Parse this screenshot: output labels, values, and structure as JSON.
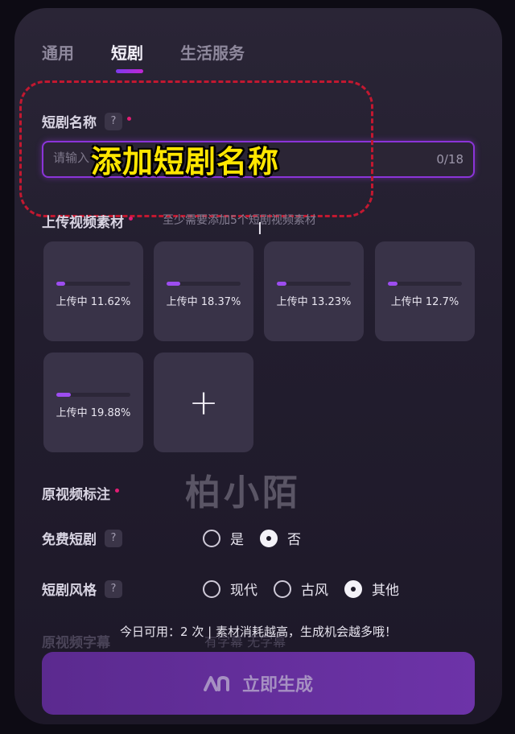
{
  "tabs": [
    {
      "label": "通用",
      "active": false
    },
    {
      "label": "短剧",
      "active": true
    },
    {
      "label": "生活服务",
      "active": false
    }
  ],
  "drama_name": {
    "label": "短剧名称",
    "help": "?",
    "placeholder": "请输入",
    "value": "",
    "counter": "0/18",
    "overlay_caption": "添加短剧名称"
  },
  "upload": {
    "label": "上传视频素材",
    "hint": "至少需要添加5个短剧视频素材",
    "items": [
      {
        "status": "上传中 11.62%",
        "progress": 0.1162
      },
      {
        "status": "上传中 18.37%",
        "progress": 0.1837
      },
      {
        "status": "上传中 13.23%",
        "progress": 0.1323
      },
      {
        "status": "上传中 12.7%",
        "progress": 0.127
      },
      {
        "status": "上传中 19.88%",
        "progress": 0.1988
      }
    ],
    "add_label": "+"
  },
  "watermark": "柏小陌",
  "original_annotation": {
    "label": "原视频标注"
  },
  "free_drama": {
    "label": "免费短剧",
    "help": "?",
    "options": [
      "是",
      "否"
    ],
    "selected": "否"
  },
  "drama_style": {
    "label": "短剧风格",
    "help": "?",
    "options": [
      "现代",
      "古风",
      "其他"
    ],
    "selected": "其他"
  },
  "subtitle_row": {
    "label": "原视频字幕",
    "options_text": "有字幕   无字幕"
  },
  "quota_text": "今日可用：2 次 | 素材消耗越高，生成机会越多哦！",
  "generate_button": {
    "label": "立即生成"
  },
  "colors": {
    "accent": "#8b34d9",
    "overlay_caption": "#ffe600",
    "dashed_outline": "#c21830"
  }
}
